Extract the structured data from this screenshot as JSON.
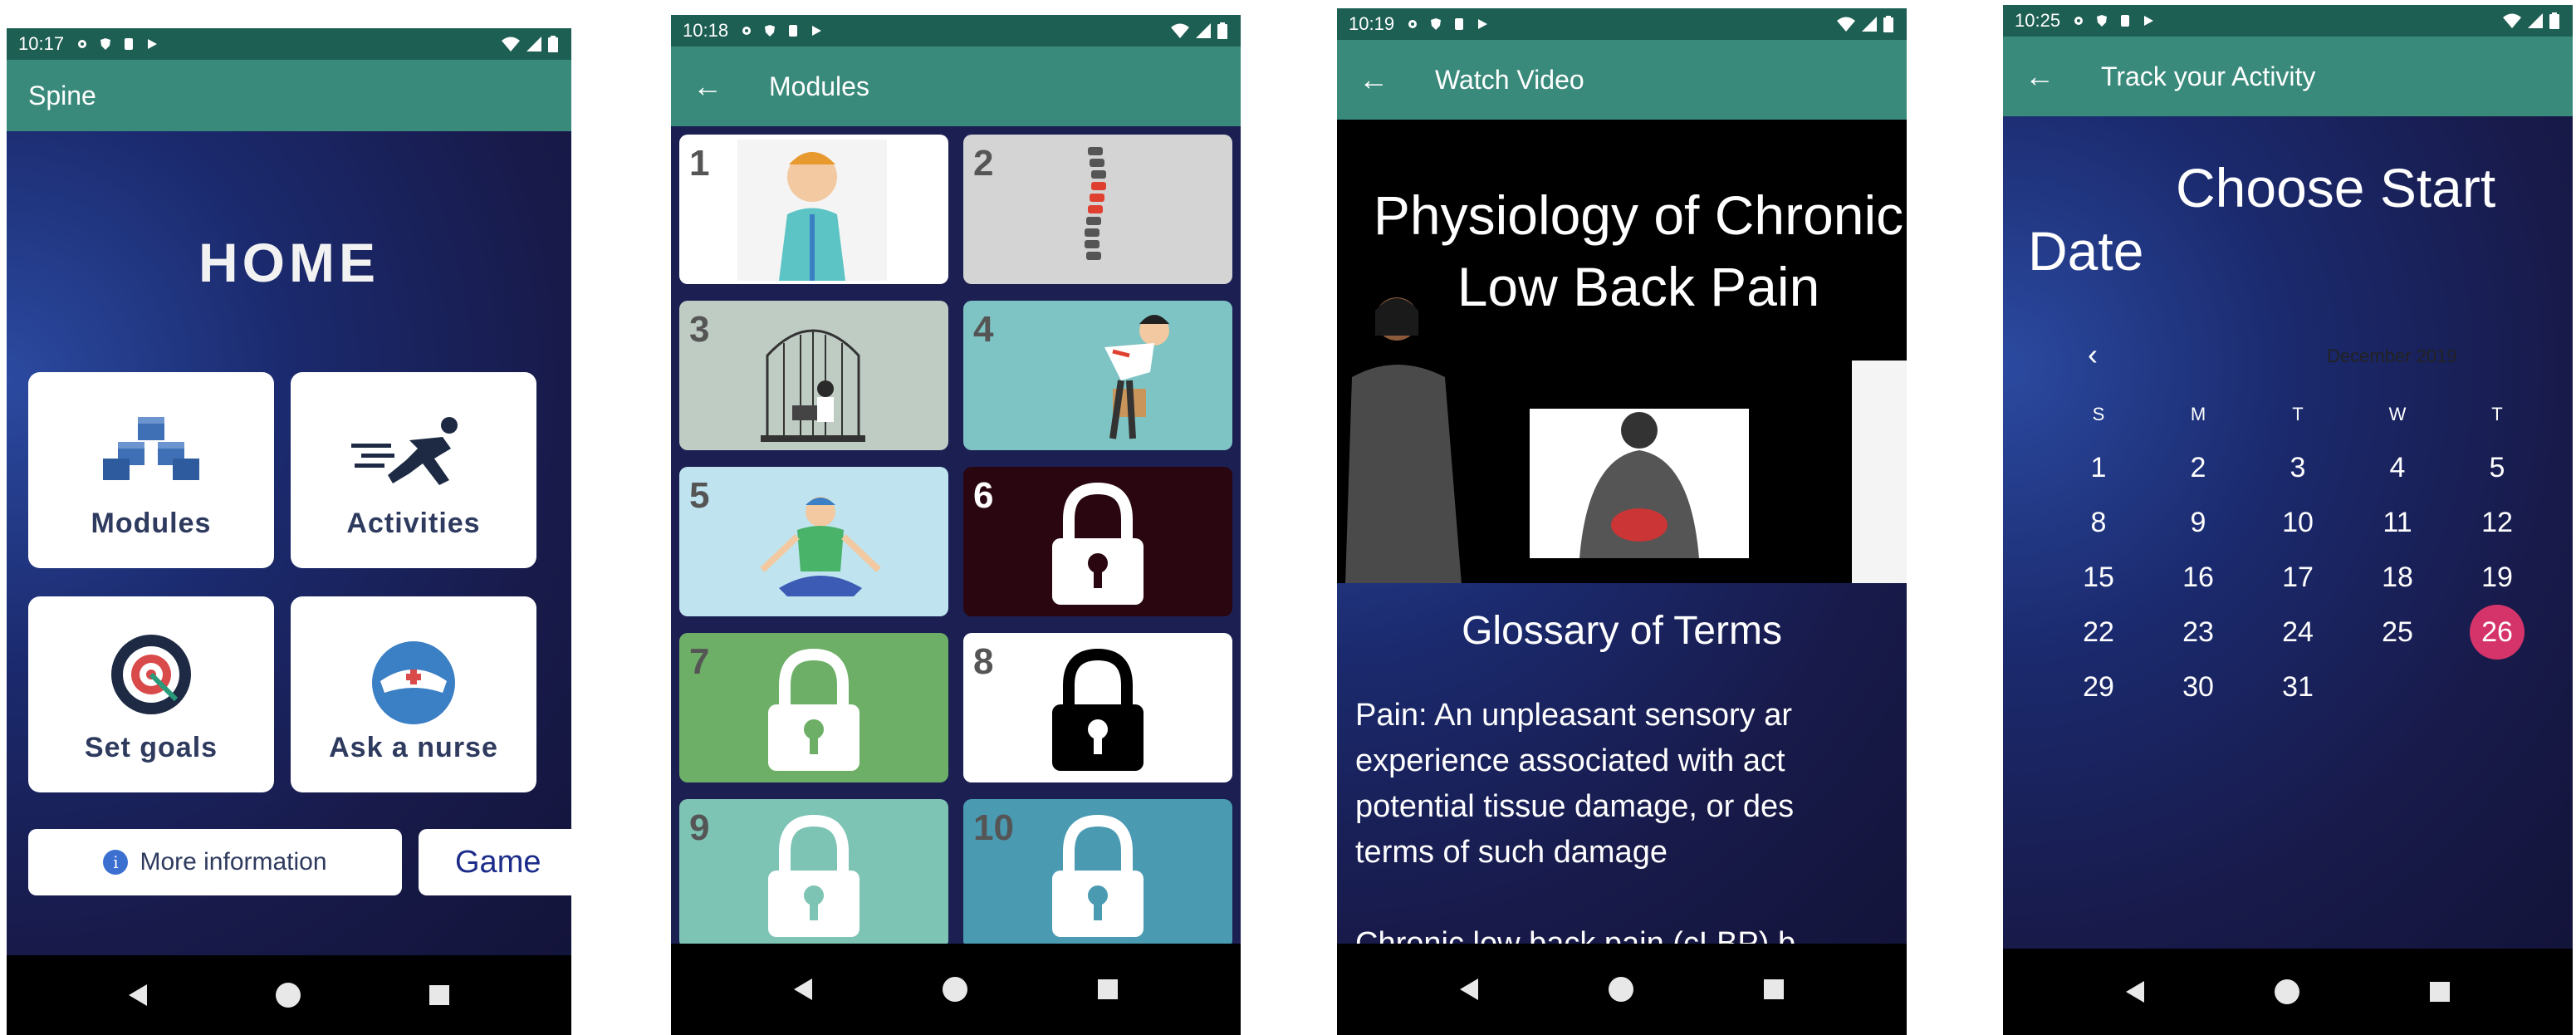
{
  "screens": {
    "home": {
      "status_time": "10:17",
      "appbar_title": "Spine",
      "title": "HOME",
      "tiles": {
        "modules": "Modules",
        "activities": "Activities",
        "set_goals": "Set goals",
        "ask_nurse": "Ask a nurse"
      },
      "more_info": "More information",
      "game": "Game"
    },
    "modules": {
      "status_time": "10:18",
      "appbar_title": "Modules",
      "items": [
        {
          "num": "1",
          "locked": false,
          "bg": "#ffffff"
        },
        {
          "num": "2",
          "locked": false,
          "bg": "#d4d4d4"
        },
        {
          "num": "3",
          "locked": false,
          "bg": "#bfccc4"
        },
        {
          "num": "4",
          "locked": false,
          "bg": "#7fc4c4"
        },
        {
          "num": "5",
          "locked": false,
          "bg": "#bfe4ef"
        },
        {
          "num": "6",
          "locked": true,
          "bg": "#2a0610"
        },
        {
          "num": "7",
          "locked": true,
          "bg": "#6daf66"
        },
        {
          "num": "8",
          "locked": true,
          "bg": "#ffffff"
        },
        {
          "num": "9",
          "locked": true,
          "bg": "#7ec4b5"
        },
        {
          "num": "10",
          "locked": true,
          "bg": "#4a9bb2"
        }
      ]
    },
    "video": {
      "status_time": "10:19",
      "appbar_title": "Watch Video",
      "slide_title_line1": "Physiology of Chronic",
      "slide_title_line2": "Low Back Pain",
      "glossary_heading": "Glossary of Terms",
      "glossary_lines": [
        "Pain: An unpleasant sensory ar",
        "experience associated with act",
        "potential tissue damage, or des",
        "terms of such damage"
      ],
      "glossary_next": "Chronic low back pain (cLBP) b"
    },
    "calendar": {
      "status_time": "10:25",
      "appbar_title": "Track your Activity",
      "title_line1": "Choose Start",
      "title_line2": "Date",
      "month_label": "December 2019",
      "prev_label": "‹",
      "weekdays": [
        "S",
        "M",
        "T",
        "W",
        "T"
      ],
      "weeks": [
        [
          "1",
          "2",
          "3",
          "4",
          "5"
        ],
        [
          "8",
          "9",
          "10",
          "11",
          "12"
        ],
        [
          "15",
          "16",
          "17",
          "18",
          "19"
        ],
        [
          "22",
          "23",
          "24",
          "25",
          "26"
        ],
        [
          "29",
          "30",
          "31",
          "",
          ""
        ]
      ],
      "selected_day": "26",
      "selected_color": "#d5346a"
    }
  },
  "colors": {
    "statusbar": "#1e5f54",
    "appbar": "#3a8a7b",
    "bg_dark": "#181a4a"
  },
  "icons": {
    "back": "arrow-left-icon",
    "lock": "padlock-icon",
    "info": "info-icon"
  }
}
